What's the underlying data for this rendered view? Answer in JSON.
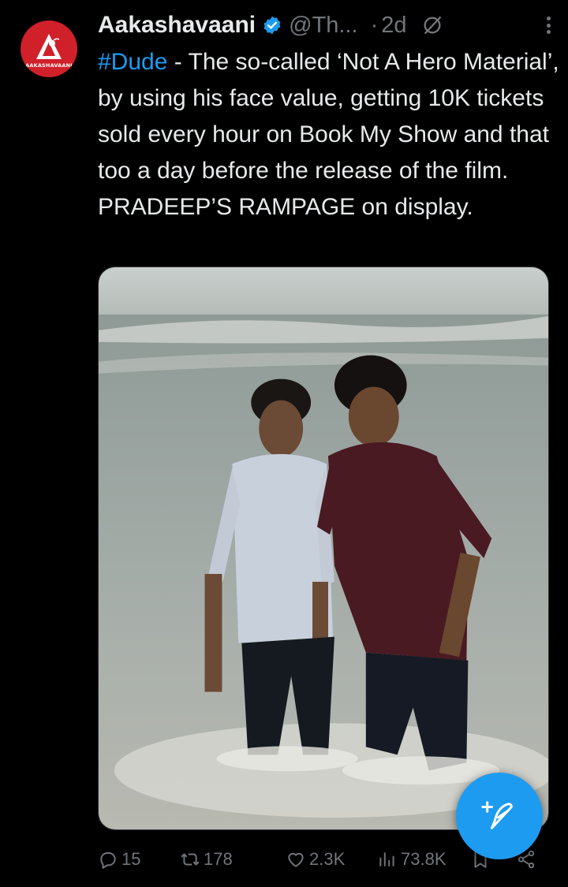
{
  "account": {
    "display_name": "Aakashavaani",
    "handle": "@Th...",
    "time_sep": "·",
    "time": "2d",
    "avatar_label": "AAKASHAVAANI",
    "verified": true
  },
  "tweet": {
    "hashtag": "#Dude",
    "text": " - The so-called ‘Not A Hero Material’, by using his face value, getting 10K tickets sold every hour on Book My Show and that too a day before the release of the film. PRADEEP’S RAMPAGE on display."
  },
  "stats": {
    "replies": "15",
    "reposts": "178",
    "likes": "2.3K",
    "views": "73.8K"
  },
  "icons": {
    "verified": "verified-badge-icon",
    "grok": "grok-icon",
    "more": "more-options-icon",
    "reply": "reply-icon",
    "repost": "repost-icon",
    "like": "heart-icon",
    "views": "views-chart-icon",
    "bookmark": "bookmark-icon",
    "share": "share-icon",
    "compose": "compose-post-icon"
  },
  "colors": {
    "background": "#000000",
    "accent": "#1d9bf0",
    "muted": "#71767b",
    "text": "#e7e9ea",
    "avatar_bg": "#d0202a"
  }
}
